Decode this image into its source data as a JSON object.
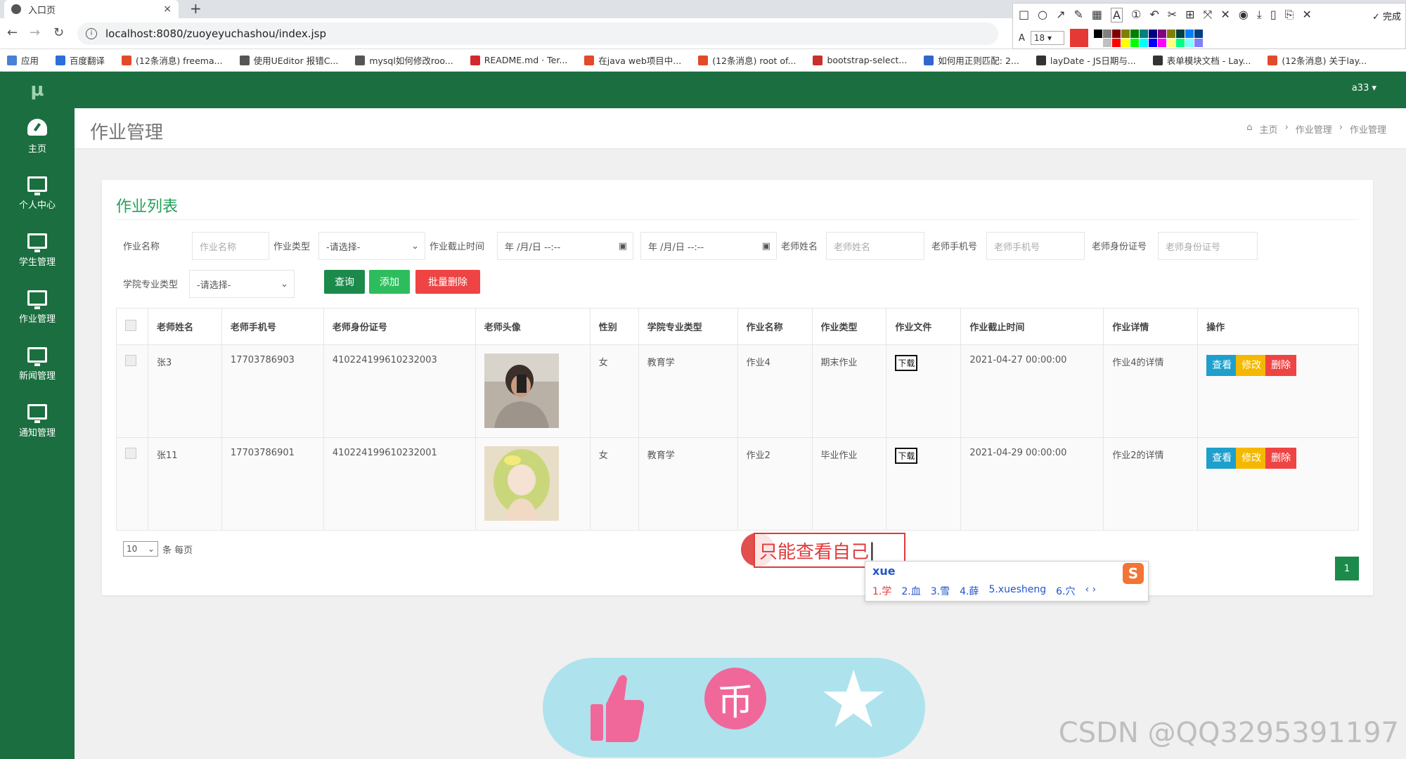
{
  "browser": {
    "tab_title": "入口页",
    "tab_close": "×",
    "new_tab": "+",
    "url": "localhost:8080/zuoyeyuchashou/index.jsp",
    "bookmarks": [
      {
        "label": "应用",
        "color": "#4a7fd6"
      },
      {
        "label": "百度翻译",
        "color": "#2a6fdb"
      },
      {
        "label": "(12条消息) freema...",
        "color": "#e24a2a"
      },
      {
        "label": "使用UEditor 报错C...",
        "color": "#555555"
      },
      {
        "label": "mysql如何修改roo...",
        "color": "#555555"
      },
      {
        "label": "README.md · Ter...",
        "color": "#d4282e"
      },
      {
        "label": "在java web项目中...",
        "color": "#e24a2a"
      },
      {
        "label": "(12条消息) root of...",
        "color": "#e24a2a"
      },
      {
        "label": "bootstrap-select...",
        "color": "#c9302c"
      },
      {
        "label": "如何用正则匹配: 2...",
        "color": "#3366cc"
      },
      {
        "label": "layDate - JS日期与...",
        "color": "#333333"
      },
      {
        "label": "表单模块文档 - Lay...",
        "color": "#333333"
      },
      {
        "label": "(12条消息) 关于lay...",
        "color": "#e24a2a"
      }
    ]
  },
  "shot_tool": {
    "font_size": "18",
    "done_label": "完成",
    "palette": [
      "#000000",
      "#808080",
      "#800000",
      "#808000",
      "#008000",
      "#008080",
      "#000080",
      "#800080",
      "#808000",
      "#004040",
      "#0080ff",
      "#004080",
      "#ffffff",
      "#c0c0c0",
      "#ff0000",
      "#ffff00",
      "#00ff00",
      "#00ffff",
      "#0000ff",
      "#ff00ff",
      "#ffff80",
      "#00ff80",
      "#80ffff",
      "#8080ff"
    ]
  },
  "app": {
    "logo": "μ",
    "user": "a33 ▾",
    "sidebar": [
      {
        "label": "主页",
        "icon": "dashboard-icon"
      },
      {
        "label": "个人中心",
        "icon": "monitor-icon"
      },
      {
        "label": "学生管理",
        "icon": "monitor-icon"
      },
      {
        "label": "作业管理",
        "icon": "monitor-icon"
      },
      {
        "label": "新闻管理",
        "icon": "monitor-icon"
      },
      {
        "label": "通知管理",
        "icon": "monitor-icon"
      }
    ],
    "page_title": "作业管理",
    "breadcrumb": [
      "主页",
      "作业管理",
      "作业管理"
    ],
    "breadcrumb_sep": "›"
  },
  "card": {
    "title": "作业列表",
    "filters": {
      "hw_name_label": "作业名称",
      "hw_name_placeholder": "作业名称",
      "hw_type_label": "作业类型",
      "hw_type_value": "-请选择-",
      "deadline_label": "作业截止时间",
      "date_from": "年 /月/日 --:--",
      "date_to": "年 /月/日 --:--",
      "teacher_name_label": "老师姓名",
      "teacher_name_placeholder": "老师姓名",
      "teacher_phone_label": "老师手机号",
      "teacher_phone_placeholder": "老师手机号",
      "teacher_id_label": "老师身份证号",
      "teacher_id_placeholder": "老师身份证号",
      "major_label": "学院专业类型",
      "major_value": "-请选择-"
    },
    "buttons": {
      "query": "查询",
      "add": "添加",
      "batch_delete": "批量删除"
    },
    "columns": [
      "老师姓名",
      "老师手机号",
      "老师身份证号",
      "老师头像",
      "性别",
      "学院专业类型",
      "作业名称",
      "作业类型",
      "作业文件",
      "作业截止时间",
      "作业详情",
      "操作"
    ],
    "rows": [
      {
        "name": "张3",
        "phone": "17703786903",
        "idcard": "410224199610232003",
        "gender": "女",
        "major": "教育学",
        "hw_name": "作业4",
        "hw_type": "期末作业",
        "file": "下载",
        "deadline": "2021-04-27 00:00:00",
        "detail": "作业4的详情"
      },
      {
        "name": "张11",
        "phone": "17703786901",
        "idcard": "410224199610232001",
        "gender": "女",
        "major": "教育学",
        "hw_name": "作业2",
        "hw_type": "毕业作业",
        "file": "下载",
        "deadline": "2021-04-29 00:00:00",
        "detail": "作业2的详情"
      }
    ],
    "actions": {
      "view": "查看",
      "edit": "修改",
      "delete": "删除"
    },
    "page_size": "10",
    "page_size_suffix": "条 每页",
    "current_page": "1"
  },
  "annotation": {
    "text": "只能查看自己"
  },
  "ime": {
    "input": "xue",
    "logo": "S",
    "candidates": [
      "1.学",
      "2.血",
      "3.雪",
      "4.薛",
      "5.xuesheng",
      "6.穴",
      "‹ ›"
    ]
  },
  "watermark": "CSDN @QQ3295391197",
  "colors": {
    "primary_green": "#1b6e3f",
    "query": "#1b8a4b",
    "add": "#2ebd5c",
    "danger": "#ee4444",
    "view": "#1e9fcc",
    "edit": "#f5b800"
  }
}
